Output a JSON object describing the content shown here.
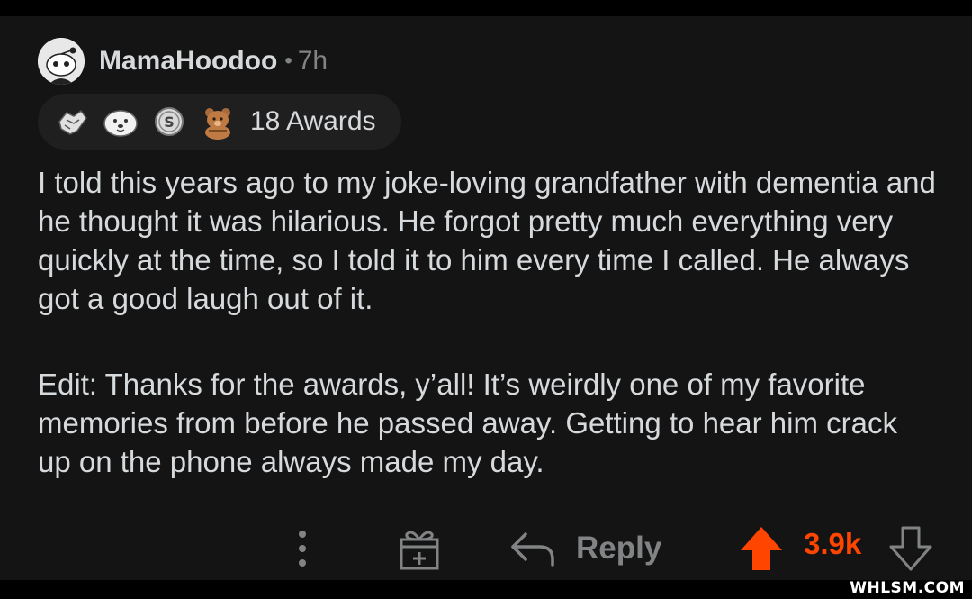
{
  "comment": {
    "author": "MamaHoodoo",
    "separator": "•",
    "time_ago": "7h",
    "awards": {
      "icons": [
        "handshake-award-icon",
        "wholesome-seal-award-icon",
        "silver-award-icon",
        "bear-award-icon"
      ],
      "count_label": "18 Awards"
    },
    "paragraphs": [
      "I told this years ago to my joke-loving grandfather with dementia and he thought it was hilarious. He forgot pretty much everything very quickly at the time, so I told it to him every time I called. He always got a good laugh out of it.",
      "Edit: Thanks for the awards, y’all! It’s weirdly one of my favorite memories from before he passed away. Getting to hear him crack up on the phone always made my day."
    ]
  },
  "actions": {
    "more_icon": "vertical-ellipsis-icon",
    "gift_icon": "gift-award-icon",
    "reply_icon": "reply-arrow-icon",
    "reply_label": "Reply",
    "upvote_icon": "upvote-arrow-icon",
    "score": "3.9k",
    "downvote_icon": "downvote-arrow-icon",
    "upvote_active": true
  },
  "colors": {
    "background": "#141414",
    "text": "#d7dadc",
    "muted": "#818384",
    "upvote": "#ff4500"
  },
  "watermark": "WHLSM.COM"
}
